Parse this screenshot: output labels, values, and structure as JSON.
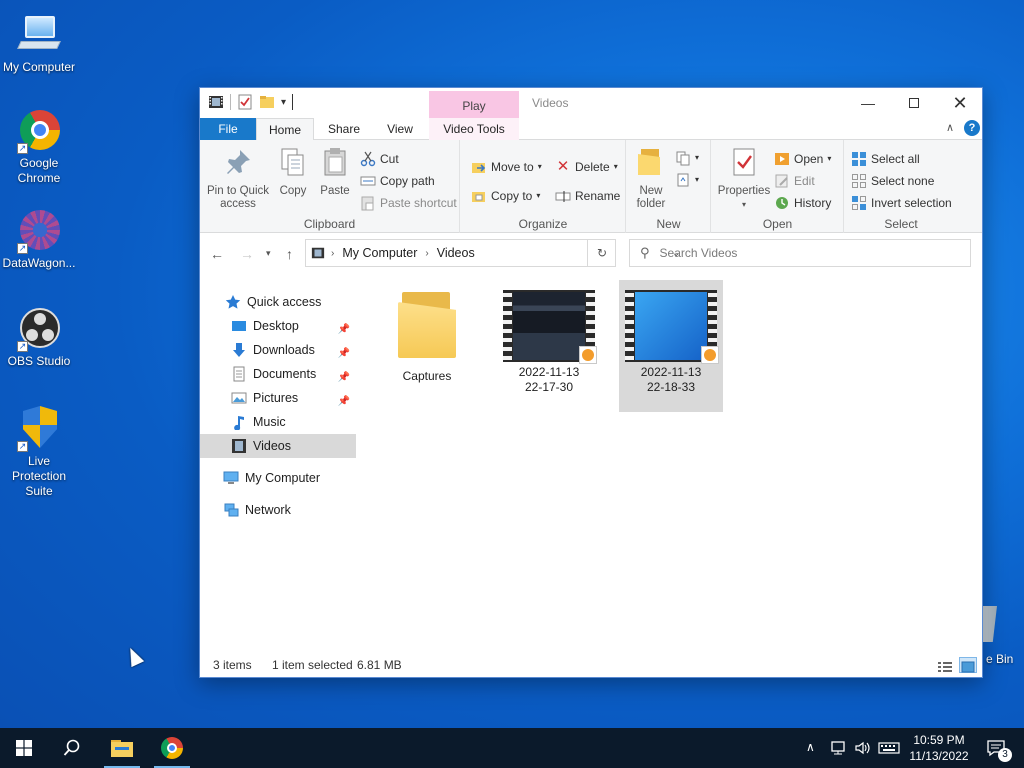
{
  "desktop": {
    "icons": [
      {
        "label": "My Computer"
      },
      {
        "label": "Google Chrome"
      },
      {
        "label": "DataWagon..."
      },
      {
        "label": "OBS Studio"
      },
      {
        "label": "Live Protection Suite"
      }
    ],
    "recycle_bin_label": "e Bin"
  },
  "window": {
    "title": "Videos",
    "contextual_tab_group": "Play",
    "tabs": {
      "file": "File",
      "home": "Home",
      "share": "Share",
      "view": "View",
      "video_tools": "Video Tools"
    },
    "ribbon": {
      "clipboard": {
        "label": "Clipboard",
        "pin": "Pin to Quick access",
        "copy": "Copy",
        "paste": "Paste",
        "cut": "Cut",
        "copy_path": "Copy path",
        "paste_shortcut": "Paste shortcut"
      },
      "organize": {
        "label": "Organize",
        "move_to": "Move to",
        "copy_to": "Copy to",
        "delete": "Delete",
        "rename": "Rename"
      },
      "new": {
        "label": "New",
        "new_folder": "New folder"
      },
      "open": {
        "label": "Open",
        "properties": "Properties",
        "open": "Open",
        "edit": "Edit",
        "history": "History"
      },
      "select": {
        "label": "Select",
        "select_all": "Select all",
        "select_none": "Select none",
        "invert": "Invert selection"
      }
    },
    "address": {
      "segments": [
        "My Computer",
        "Videos"
      ]
    },
    "search_placeholder": "Search Videos",
    "nav": {
      "quick_access": "Quick access",
      "items": [
        "Desktop",
        "Downloads",
        "Documents",
        "Pictures",
        "Music",
        "Videos"
      ],
      "my_computer": "My Computer",
      "network": "Network"
    },
    "files": [
      {
        "name": "Captures",
        "type": "folder"
      },
      {
        "name_line1": "2022-11-13",
        "name_line2": "22-17-30",
        "type": "video"
      },
      {
        "name_line1": "2022-11-13",
        "name_line2": "22-18-33",
        "type": "video",
        "selected": true
      }
    ],
    "status": {
      "items": "3 items",
      "selected": "1 item selected",
      "size": "6.81 MB"
    }
  },
  "taskbar": {
    "time": "10:59 PM",
    "date": "11/13/2022",
    "notifications": "3"
  }
}
